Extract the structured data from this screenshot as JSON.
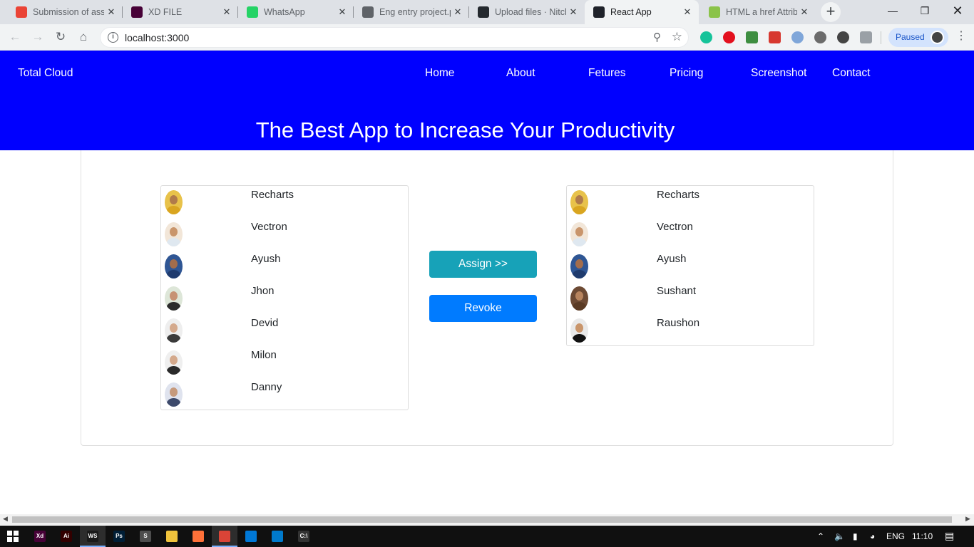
{
  "browser": {
    "tabs": [
      {
        "title": "Submission of assignment",
        "favicon": "gmail-icon",
        "color": "#ea4335",
        "active": false
      },
      {
        "title": "XD FILE",
        "favicon": "adobe-xd-icon",
        "color": "#470137",
        "active": false
      },
      {
        "title": "WhatsApp",
        "favicon": "whatsapp-icon",
        "color": "#25d366",
        "active": false
      },
      {
        "title": "Eng entry project.pdf",
        "favicon": "globe-icon",
        "color": "#5f6368",
        "active": false
      },
      {
        "title": "Upload files · Nitch",
        "favicon": "github-icon",
        "color": "#24292e",
        "active": false
      },
      {
        "title": "React App",
        "favicon": "react-icon",
        "color": "#20232a",
        "active": true
      },
      {
        "title": "HTML a href Attribute",
        "favicon": "w3schools-icon",
        "color": "#8bc34a",
        "active": false
      }
    ],
    "url": "localhost:3000",
    "profile_status": "Paused"
  },
  "page": {
    "brand": "Total Cloud",
    "nav": [
      "Home",
      "About",
      "Fetures",
      "Pricing",
      "Screenshot",
      "Contact"
    ],
    "hero_title": "The Best App to Increase Your Productivity",
    "available_users": [
      {
        "name": "Recharts",
        "skin": "#b07a4a",
        "shirt": "#d9a520",
        "bg": "#e8c24a"
      },
      {
        "name": "Vectron",
        "skin": "#c9956b",
        "shirt": "#dfe8f0",
        "bg": "#f2e6d8"
      },
      {
        "name": "Ayush",
        "skin": "#a36d4c",
        "shirt": "#1f3b6e",
        "bg": "#2f5694"
      },
      {
        "name": "Jhon",
        "skin": "#c79274",
        "shirt": "#2b2b2b",
        "bg": "#dde6d8"
      },
      {
        "name": "Devid",
        "skin": "#d4a98c",
        "shirt": "#3a3a3a",
        "bg": "#eeeeee"
      },
      {
        "name": "Milon",
        "skin": "#d4a98c",
        "shirt": "#2a2a2a",
        "bg": "#efefef"
      },
      {
        "name": "Danny",
        "skin": "#c69a7c",
        "shirt": "#3d4a6b",
        "bg": "#dfe3ee"
      }
    ],
    "assigned_users": [
      {
        "name": "Recharts",
        "skin": "#b07a4a",
        "shirt": "#d9a520",
        "bg": "#e8c24a"
      },
      {
        "name": "Vectron",
        "skin": "#c9956b",
        "shirt": "#dfe8f0",
        "bg": "#f2e6d8"
      },
      {
        "name": "Ayush",
        "skin": "#a36d4c",
        "shirt": "#1f3b6e",
        "bg": "#2f5694"
      },
      {
        "name": "Sushant",
        "skin": "#b8845e",
        "shirt": "#5a3a24",
        "bg": "#6d4a34"
      },
      {
        "name": "Raushon",
        "skin": "#c9956b",
        "shirt": "#111111",
        "bg": "#e9e9e9"
      }
    ],
    "assign_label": "Assign >>",
    "revoke_label": "Revoke",
    "colors": {
      "hero_bg": "#0000ff",
      "assign_btn": "#17a2b8",
      "revoke_btn": "#007bff"
    }
  },
  "taskbar": {
    "apps": [
      {
        "name": "adobe-xd-taskbar-icon",
        "label": "Xd",
        "color": "#470137"
      },
      {
        "name": "illustrator-taskbar-icon",
        "label": "Ai",
        "color": "#330000"
      },
      {
        "name": "webstorm-taskbar-icon",
        "label": "WS",
        "color": "#1a1a1a"
      },
      {
        "name": "photoshop-taskbar-icon",
        "label": "Ps",
        "color": "#001e36"
      },
      {
        "name": "sublime-taskbar-icon",
        "label": "S",
        "color": "#4d4d4d"
      },
      {
        "name": "file-explorer-taskbar-icon",
        "label": "",
        "color": "#f0c33c"
      },
      {
        "name": "firefox-taskbar-icon",
        "label": "",
        "color": "#ff7139"
      },
      {
        "name": "chrome-taskbar-icon",
        "label": "",
        "color": "#db4437"
      },
      {
        "name": "store-taskbar-icon",
        "label": "",
        "color": "#0078d7"
      },
      {
        "name": "vscode-taskbar-icon",
        "label": "",
        "color": "#007acc"
      },
      {
        "name": "terminal-taskbar-icon",
        "label": "C:\\",
        "color": "#333333"
      }
    ],
    "language": "ENG",
    "time": "11:10"
  }
}
